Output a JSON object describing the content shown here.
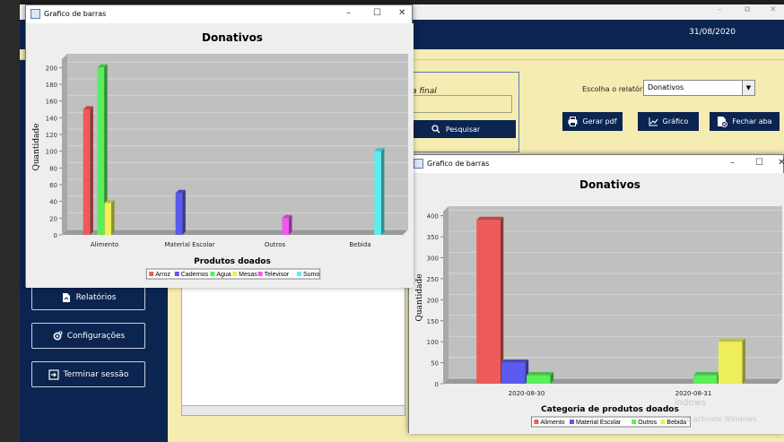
{
  "main_window": {
    "date": "31/08/2020",
    "controls": {
      "minimize": "–",
      "maximize": "⧉",
      "close": "✕"
    }
  },
  "sidebar": {
    "reports": "Relatórios",
    "settings": "Configurações",
    "logout": "Terminar sessão"
  },
  "filters": {
    "end_date_label": "Data final",
    "end_date_value": "- -",
    "search": "Pesquisar"
  },
  "report_panel": {
    "label": "Escolha o relatório",
    "selected": "Donativos",
    "pdf": "Gerar pdf",
    "chart": "Gráfico",
    "close_tab": "Fechar aba"
  },
  "window_1": {
    "title": "Grafico de barras",
    "controls": {
      "minimize": "–",
      "maximize": "☐",
      "close": "✕"
    }
  },
  "window_2": {
    "title": "Grafico de barras",
    "controls": {
      "minimize": "–",
      "maximize": "☐",
      "close": "✕"
    }
  },
  "watermark": {
    "line1": "indows",
    "line2": "to activate Windows."
  },
  "colors": {
    "navy": "#0b2450",
    "panel_bg": "#f5ecb2",
    "red": "#ee5a5a",
    "blue": "#5a5aee",
    "green": "#5aee5a",
    "yellow": "#eeee5a",
    "magenta": "#ee5aee",
    "cyan": "#5aeeee"
  },
  "chart_data": [
    {
      "type": "bar",
      "title": "Donativos",
      "xlabel": "Produtos doados",
      "ylabel": "Quantidade",
      "ylim": [
        0,
        210
      ],
      "yticks": [
        0,
        20,
        40,
        60,
        80,
        100,
        120,
        140,
        160,
        180,
        200
      ],
      "categories": [
        "Alimento",
        "Material Escolar",
        "Outros",
        "Bebida"
      ],
      "series": [
        {
          "name": "Arroz",
          "color": "#ee5a5a",
          "values": [
            150,
            0,
            0,
            0
          ]
        },
        {
          "name": "Cadernos",
          "color": "#5a5aee",
          "values": [
            0,
            50,
            0,
            0
          ]
        },
        {
          "name": "Agua",
          "color": "#5aee5a",
          "values": [
            200,
            0,
            0,
            0
          ]
        },
        {
          "name": "Mesas",
          "color": "#eeee5a",
          "values": [
            38,
            0,
            0,
            0
          ]
        },
        {
          "name": "Televisor",
          "color": "#ee5aee",
          "values": [
            0,
            0,
            20,
            0
          ]
        },
        {
          "name": "Sumo",
          "color": "#5aeeee",
          "values": [
            0,
            0,
            0,
            100
          ]
        }
      ],
      "legend": "bottom",
      "grid": true
    },
    {
      "type": "bar",
      "title": "Donativos",
      "xlabel": "Categoria de produtos doados",
      "ylabel": "Quantidade",
      "ylim": [
        0,
        410
      ],
      "yticks": [
        0,
        50,
        100,
        150,
        200,
        250,
        300,
        350,
        400
      ],
      "categories": [
        "2020-08-30",
        "2020-08-31"
      ],
      "series": [
        {
          "name": "Alimento",
          "color": "#ee5a5a",
          "values": [
            390,
            0
          ]
        },
        {
          "name": "Material Escolar",
          "color": "#5a5aee",
          "values": [
            50,
            0
          ]
        },
        {
          "name": "Outros",
          "color": "#5aee5a",
          "values": [
            20,
            20
          ]
        },
        {
          "name": "Bebida",
          "color": "#eeee5a",
          "values": [
            0,
            100
          ]
        }
      ],
      "legend": "bottom",
      "grid": true
    }
  ]
}
